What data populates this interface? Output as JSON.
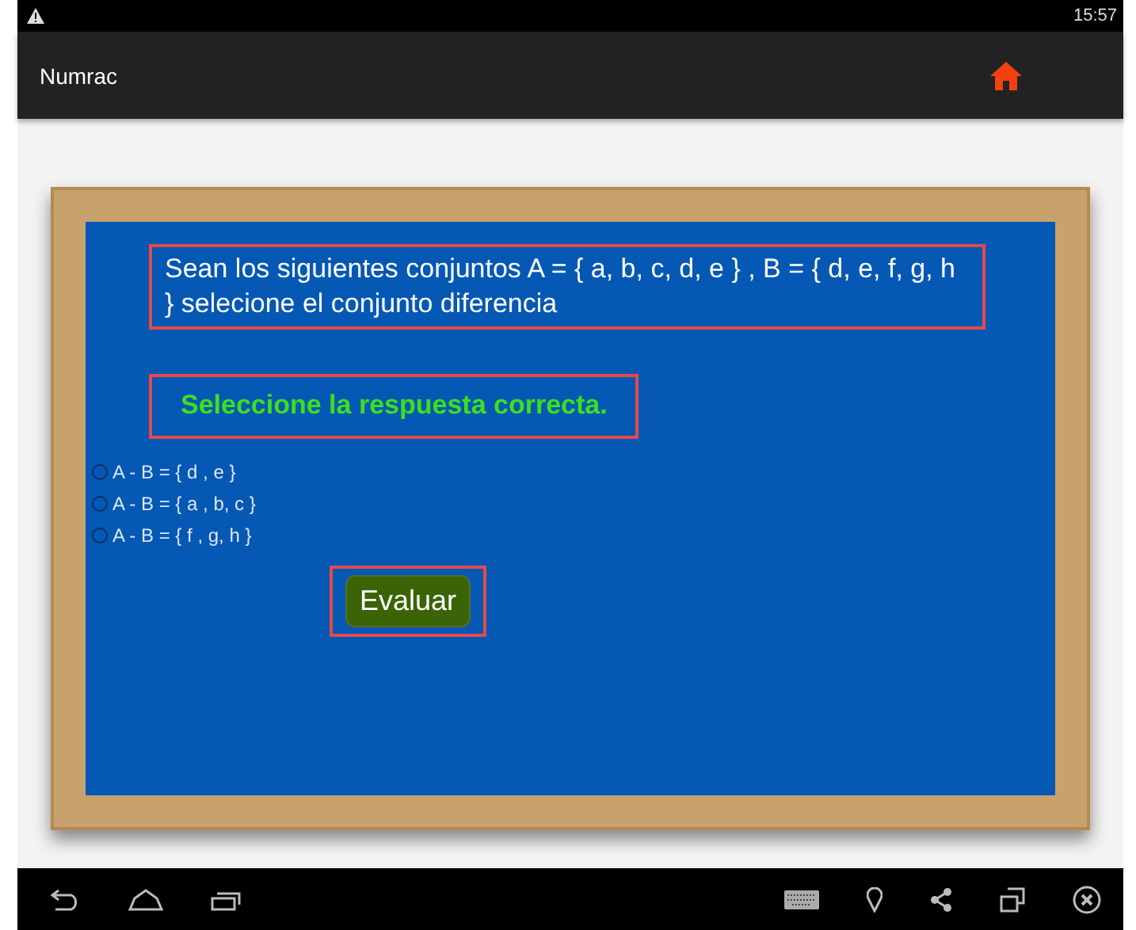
{
  "status_bar": {
    "time": "15:57"
  },
  "action_bar": {
    "title": "Numrac"
  },
  "question": {
    "text": "Sean los siguientes conjuntos A = { a, b, c, d, e } , B = { d, e, f, g, h } selecione el conjunto diferencia"
  },
  "instruction": "Seleccione la respuesta correcta.",
  "options": [
    {
      "label": "A - B = { d , e }",
      "selected": false
    },
    {
      "label": "A - B = { a , b, c }",
      "selected": false
    },
    {
      "label": "A - B = { f , g, h }",
      "selected": false
    }
  ],
  "evaluate_button": "Evaluar"
}
